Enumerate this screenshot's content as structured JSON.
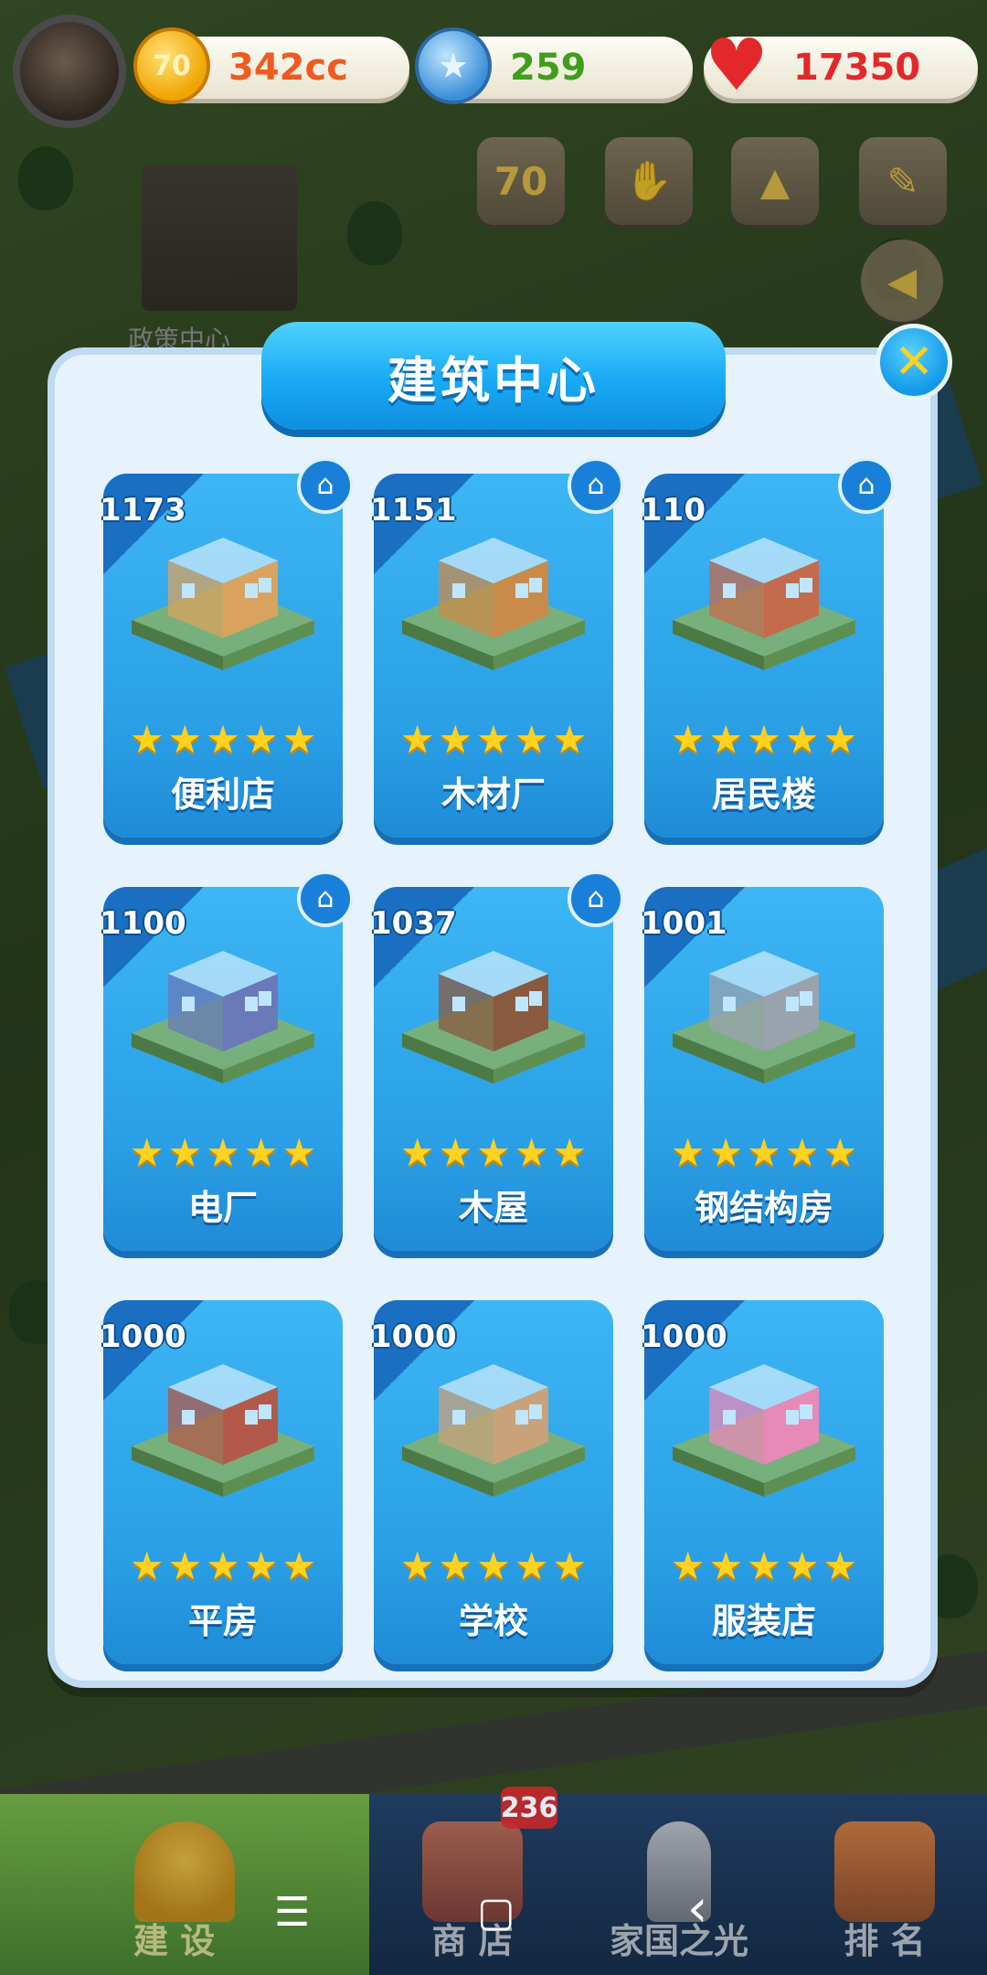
{
  "resources": {
    "coin": {
      "value": "342cc",
      "icon": "coin-70-icon"
    },
    "star": {
      "value": "259",
      "icon": "blue-star-icon"
    },
    "heart": {
      "value": "17350",
      "icon": "heart-icon"
    }
  },
  "top_icons": [
    "70-anniversary-icon",
    "handshake-icon",
    "rocket-icon",
    "clipboard-icon",
    "megaphone-icon"
  ],
  "background": {
    "building_label": "政策中心"
  },
  "modal": {
    "title": "建筑中心",
    "close_icon": "close-icon",
    "cards": [
      {
        "count": "1173",
        "name": "便利店",
        "stars": 5,
        "home": true,
        "art_color": "#d9a35f"
      },
      {
        "count": "1151",
        "name": "木材厂",
        "stars": 5,
        "home": true,
        "art_color": "#c98b4a"
      },
      {
        "count": "110",
        "name": "居民楼",
        "stars": 5,
        "home": true,
        "art_color": "#c46b4d"
      },
      {
        "count": "1100",
        "name": "电厂",
        "stars": 5,
        "home": true,
        "art_color": "#6a79b8"
      },
      {
        "count": "1037",
        "name": "木屋",
        "stars": 5,
        "home": true,
        "art_color": "#8a5a40"
      },
      {
        "count": "1001",
        "name": "钢结构房",
        "stars": 5,
        "home": false,
        "art_color": "#9aa3ad"
      },
      {
        "count": "1000",
        "name": "平房",
        "stars": 5,
        "home": false,
        "art_color": "#b2594a"
      },
      {
        "count": "1000",
        "name": "学校",
        "stars": 5,
        "home": false,
        "art_color": "#c9a27a"
      },
      {
        "count": "1000",
        "name": "服装店",
        "stars": 5,
        "home": false,
        "art_color": "#e889b8"
      }
    ]
  },
  "bottom_nav": {
    "badge": "236",
    "tabs": [
      {
        "label": "建 设",
        "icon": "hardhat-icon"
      },
      {
        "label": "商 店",
        "icon": "shop-icon"
      },
      {
        "label": "家国之光",
        "icon": "rocket-icon"
      },
      {
        "label": "排 名",
        "icon": "podium-icon"
      }
    ]
  },
  "system_nav": {
    "menu": "☰",
    "home": "▢",
    "back": "‹"
  },
  "colors": {
    "panel_bg": "#e6f2fc",
    "card_blue": "#2a9fe6",
    "title_blue": "#18a9f5",
    "star_gold": "#ffd21f"
  }
}
